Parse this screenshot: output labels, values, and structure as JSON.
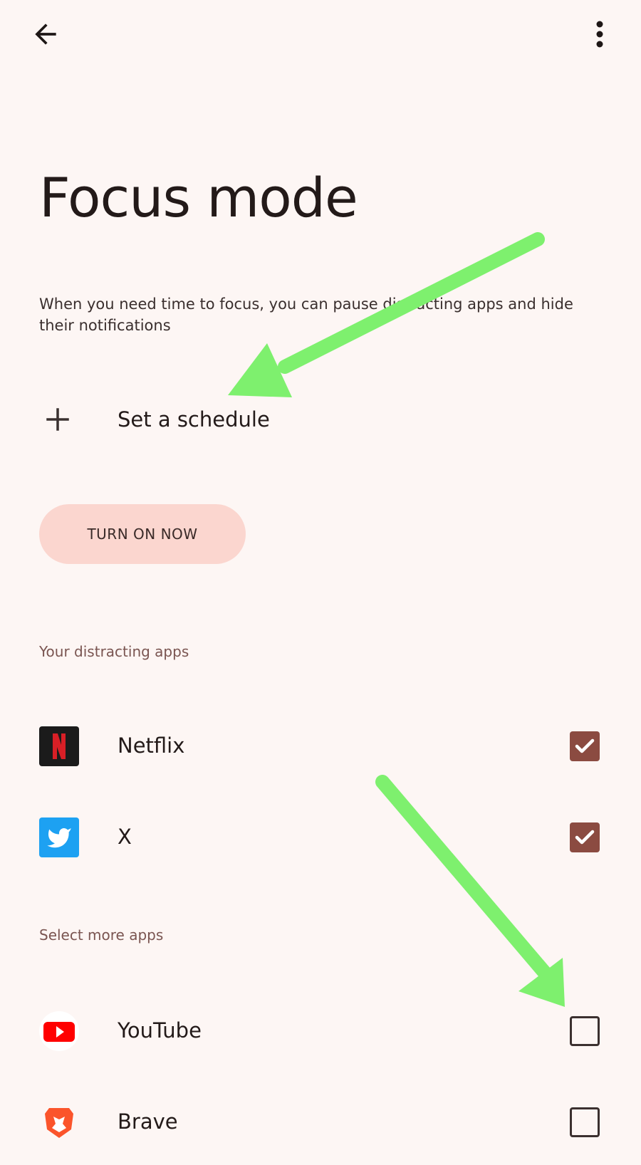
{
  "header": {
    "back_icon": "arrow-back-icon",
    "more_icon": "more-vert-icon"
  },
  "page": {
    "title": "Focus mode",
    "description": "When you need time to focus, you can pause distracting apps and hide their notifications"
  },
  "schedule": {
    "label": "Set a schedule",
    "icon": "plus-icon"
  },
  "turn_on_button": {
    "label": "TURN ON NOW"
  },
  "sections": {
    "distracting": "Your distracting apps",
    "more": "Select more apps"
  },
  "distracting_apps": [
    {
      "name": "Netflix",
      "checked": true,
      "icon": "netflix-icon"
    },
    {
      "name": "X",
      "checked": true,
      "icon": "twitter-bird-icon"
    }
  ],
  "more_apps": [
    {
      "name": "YouTube",
      "checked": false,
      "icon": "youtube-icon"
    },
    {
      "name": "Brave",
      "checked": false,
      "icon": "brave-lion-icon"
    }
  ],
  "colors": {
    "background": "#fdf6f4",
    "button_bg": "#fbd6cf",
    "checkbox_checked": "#8b4b41",
    "section_header": "#7a5551",
    "annotation_arrow": "#7ef06e"
  }
}
